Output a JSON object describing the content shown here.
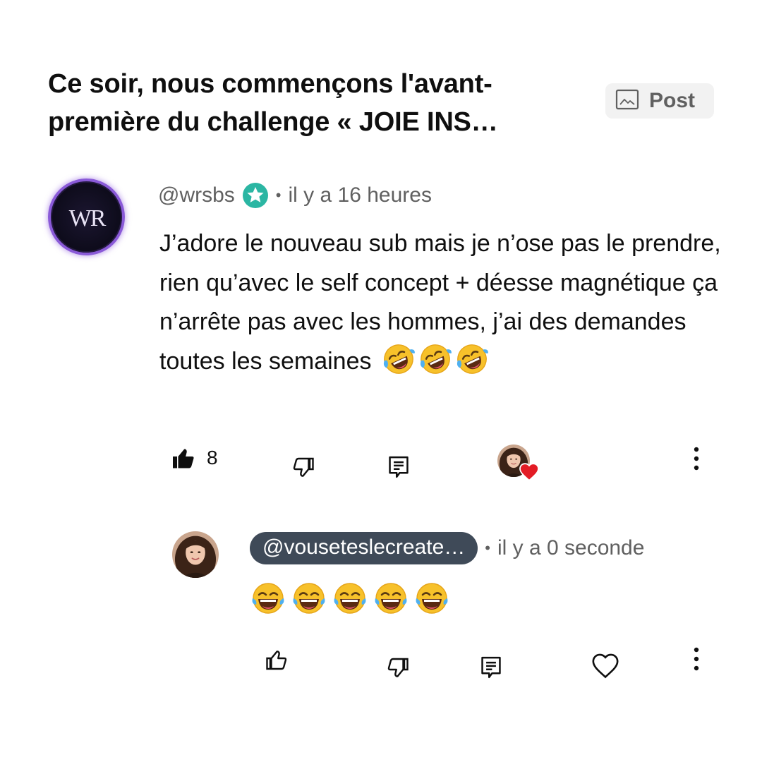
{
  "post": {
    "title": "Ce soir, nous commençons l'avant-\npremière du challenge « JOIE INS…",
    "chip_label": "Post",
    "chip_icon": "image-icon"
  },
  "comment": {
    "handle": "@wrsbs",
    "badge_icon": "star-badge-icon",
    "time": "il y a 16 heures",
    "avatar_text": "WR",
    "text": "J’adore le nouveau sub mais je n’ose pas le prendre, rien qu’avec le self concept + déesse magnétique ça n’arrête pas avec les hommes, j’ai des demandes toutes les semaines",
    "emojis": [
      "rolling-on-floor-laughing",
      "rolling-on-floor-laughing",
      "rolling-on-floor-laughing"
    ],
    "like_count": "8",
    "actions": {
      "like_icon": "thumbs-up-filled-icon",
      "dislike_icon": "thumbs-down-icon",
      "reply_icon": "comment-icon",
      "creator_heart_icon": "creator-heart-icon",
      "more_icon": "more-vertical-icon"
    }
  },
  "reply": {
    "handle": "@vouseteslecreate…",
    "time": "il y a 0 seconde",
    "emojis": [
      "face-with-tears-of-joy",
      "face-with-tears-of-joy",
      "face-with-tears-of-joy",
      "face-with-tears-of-joy",
      "face-with-tears-of-joy"
    ],
    "actions": {
      "like_icon": "thumbs-up-icon",
      "dislike_icon": "thumbs-down-icon",
      "reply_icon": "comment-icon",
      "heart_icon": "heart-outline-icon",
      "more_icon": "more-vertical-icon"
    }
  },
  "colors": {
    "text_primary": "#0f0f0f",
    "text_secondary": "#606060",
    "verified_teal": "#2bb6a3",
    "pill_bg": "#3f4a58",
    "heart_red": "#e31c25",
    "avatar_ring": "#8a5ad8"
  }
}
